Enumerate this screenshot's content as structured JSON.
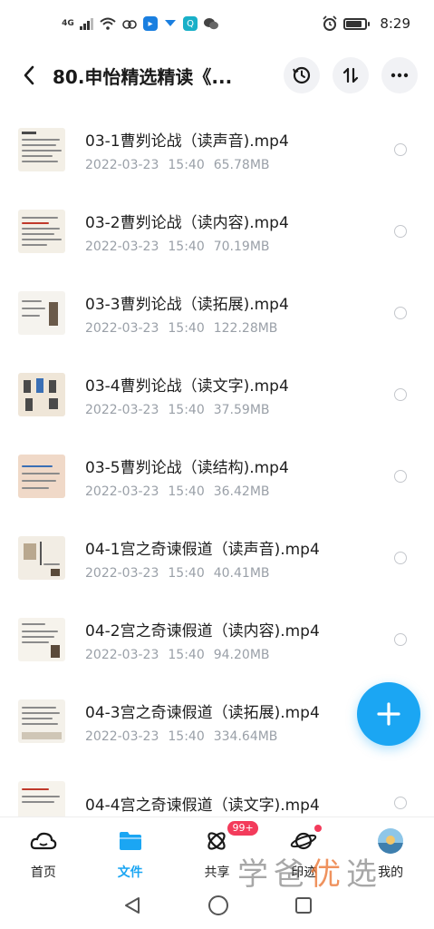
{
  "status_bar": {
    "network": "4G",
    "signal": "signal-icon",
    "icons": [
      "wifi-icon",
      "cloud-icon",
      "app-badge-icon",
      "chat-icon",
      "search-app-icon",
      "wechat-icon"
    ],
    "alarm": "alarm-icon",
    "battery_level": 0.85,
    "time": "8:29"
  },
  "header": {
    "title": "80.申怡精选精读《...",
    "actions": [
      "history-icon",
      "sort-icon",
      "more-icon"
    ]
  },
  "files": [
    {
      "name": "03-1曹刿论战（读声音).mp4",
      "date": "2022-03-23",
      "time": "15:40",
      "size": "65.78MB"
    },
    {
      "name": "03-2曹刿论战（读内容).mp4",
      "date": "2022-03-23",
      "time": "15:40",
      "size": "70.19MB"
    },
    {
      "name": "03-3曹刿论战（读拓展).mp4",
      "date": "2022-03-23",
      "time": "15:40",
      "size": "122.28MB"
    },
    {
      "name": "03-4曹刿论战（读文字).mp4",
      "date": "2022-03-23",
      "time": "15:40",
      "size": "37.59MB"
    },
    {
      "name": "03-5曹刿论战（读结构).mp4",
      "date": "2022-03-23",
      "time": "15:40",
      "size": "36.42MB"
    },
    {
      "name": "04-1宫之奇谏假道（读声音).mp4",
      "date": "2022-03-23",
      "time": "15:40",
      "size": "40.41MB"
    },
    {
      "name": "04-2宫之奇谏假道（读内容).mp4",
      "date": "2022-03-23",
      "time": "15:40",
      "size": "94.20MB"
    },
    {
      "name": "04-3宫之奇谏假道（读拓展).mp4",
      "date": "2022-03-23",
      "time": "15:40",
      "size": "334.64MB"
    },
    {
      "name": "04-4宫之奇谏假道（读文字).mp4",
      "date": "",
      "time": "",
      "size": ""
    }
  ],
  "bottom_nav": [
    {
      "label": "首页",
      "icon": "home-cloud-icon",
      "active": false
    },
    {
      "label": "文件",
      "icon": "folder-icon",
      "active": true
    },
    {
      "label": "共享",
      "icon": "share-icon",
      "active": false,
      "badge": "99+"
    },
    {
      "label": "印迹",
      "icon": "planet-icon",
      "active": false,
      "dot": true
    },
    {
      "label": "我的",
      "icon": "avatar",
      "active": false
    }
  ],
  "watermark": {
    "part1": "学爸",
    "part2": "优",
    "part3": "选"
  },
  "colors": {
    "accent": "#1ba6f3",
    "badge": "#f33b5b",
    "meta": "#9aa0a8"
  }
}
